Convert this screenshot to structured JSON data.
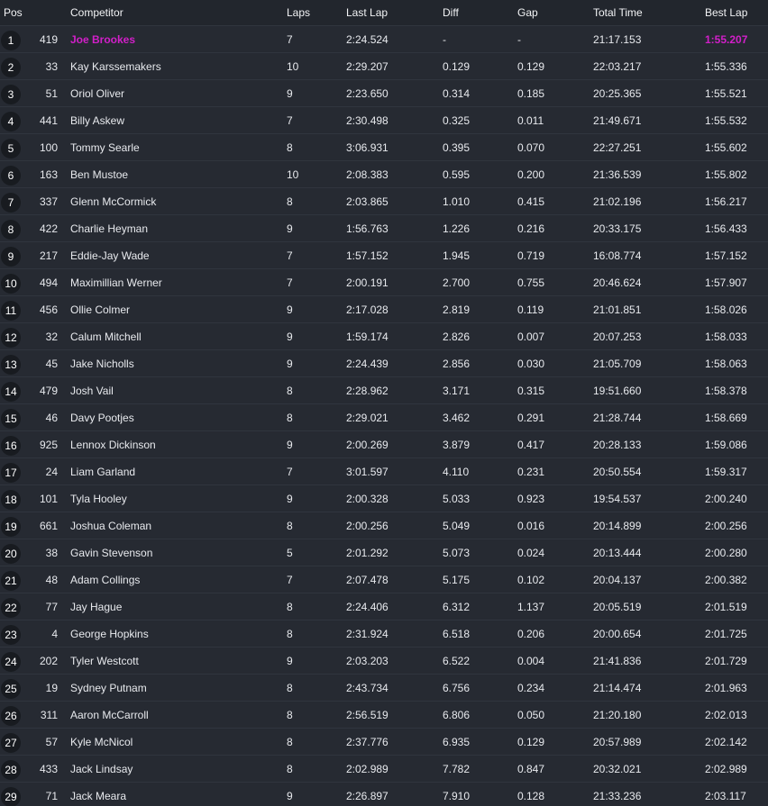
{
  "colors": {
    "background": "#242830",
    "row_divider": "#30353e",
    "badge_bg": "#181b20",
    "leader_highlight": "#d21fc9"
  },
  "columns": {
    "pos": "Pos",
    "competitor": "Competitor",
    "laps": "Laps",
    "last_lap": "Last Lap",
    "diff": "Diff",
    "gap": "Gap",
    "total_time": "Total Time",
    "best_lap": "Best Lap"
  },
  "rows": [
    {
      "pos": "1",
      "num": "419",
      "name": "Joe Brookes",
      "laps": "7",
      "last": "2:24.524",
      "diff": "-",
      "gap": "-",
      "total": "21:17.153",
      "best": "1:55.207"
    },
    {
      "pos": "2",
      "num": "33",
      "name": "Kay Karssemakers",
      "laps": "10",
      "last": "2:29.207",
      "diff": "0.129",
      "gap": "0.129",
      "total": "22:03.217",
      "best": "1:55.336"
    },
    {
      "pos": "3",
      "num": "51",
      "name": "Oriol Oliver",
      "laps": "9",
      "last": "2:23.650",
      "diff": "0.314",
      "gap": "0.185",
      "total": "20:25.365",
      "best": "1:55.521"
    },
    {
      "pos": "4",
      "num": "441",
      "name": "Billy Askew",
      "laps": "7",
      "last": "2:30.498",
      "diff": "0.325",
      "gap": "0.011",
      "total": "21:49.671",
      "best": "1:55.532"
    },
    {
      "pos": "5",
      "num": "100",
      "name": "Tommy Searle",
      "laps": "8",
      "last": "3:06.931",
      "diff": "0.395",
      "gap": "0.070",
      "total": "22:27.251",
      "best": "1:55.602"
    },
    {
      "pos": "6",
      "num": "163",
      "name": "Ben Mustoe",
      "laps": "10",
      "last": "2:08.383",
      "diff": "0.595",
      "gap": "0.200",
      "total": "21:36.539",
      "best": "1:55.802"
    },
    {
      "pos": "7",
      "num": "337",
      "name": "Glenn McCormick",
      "laps": "8",
      "last": "2:03.865",
      "diff": "1.010",
      "gap": "0.415",
      "total": "21:02.196",
      "best": "1:56.217"
    },
    {
      "pos": "8",
      "num": "422",
      "name": "Charlie Heyman",
      "laps": "9",
      "last": "1:56.763",
      "diff": "1.226",
      "gap": "0.216",
      "total": "20:33.175",
      "best": "1:56.433"
    },
    {
      "pos": "9",
      "num": "217",
      "name": "Eddie-Jay Wade",
      "laps": "7",
      "last": "1:57.152",
      "diff": "1.945",
      "gap": "0.719",
      "total": "16:08.774",
      "best": "1:57.152"
    },
    {
      "pos": "10",
      "num": "494",
      "name": "Maximillian Werner",
      "laps": "7",
      "last": "2:00.191",
      "diff": "2.700",
      "gap": "0.755",
      "total": "20:46.624",
      "best": "1:57.907"
    },
    {
      "pos": "11",
      "num": "456",
      "name": "Ollie Colmer",
      "laps": "9",
      "last": "2:17.028",
      "diff": "2.819",
      "gap": "0.119",
      "total": "21:01.851",
      "best": "1:58.026"
    },
    {
      "pos": "12",
      "num": "32",
      "name": "Calum Mitchell",
      "laps": "9",
      "last": "1:59.174",
      "diff": "2.826",
      "gap": "0.007",
      "total": "20:07.253",
      "best": "1:58.033"
    },
    {
      "pos": "13",
      "num": "45",
      "name": "Jake Nicholls",
      "laps": "9",
      "last": "2:24.439",
      "diff": "2.856",
      "gap": "0.030",
      "total": "21:05.709",
      "best": "1:58.063"
    },
    {
      "pos": "14",
      "num": "479",
      "name": "Josh Vail",
      "laps": "8",
      "last": "2:28.962",
      "diff": "3.171",
      "gap": "0.315",
      "total": "19:51.660",
      "best": "1:58.378"
    },
    {
      "pos": "15",
      "num": "46",
      "name": "Davy Pootjes",
      "laps": "8",
      "last": "2:29.021",
      "diff": "3.462",
      "gap": "0.291",
      "total": "21:28.744",
      "best": "1:58.669"
    },
    {
      "pos": "16",
      "num": "925",
      "name": "Lennox Dickinson",
      "laps": "9",
      "last": "2:00.269",
      "diff": "3.879",
      "gap": "0.417",
      "total": "20:28.133",
      "best": "1:59.086"
    },
    {
      "pos": "17",
      "num": "24",
      "name": "Liam Garland",
      "laps": "7",
      "last": "3:01.597",
      "diff": "4.110",
      "gap": "0.231",
      "total": "20:50.554",
      "best": "1:59.317"
    },
    {
      "pos": "18",
      "num": "101",
      "name": "Tyla Hooley",
      "laps": "9",
      "last": "2:00.328",
      "diff": "5.033",
      "gap": "0.923",
      "total": "19:54.537",
      "best": "2:00.240"
    },
    {
      "pos": "19",
      "num": "661",
      "name": "Joshua Coleman",
      "laps": "8",
      "last": "2:00.256",
      "diff": "5.049",
      "gap": "0.016",
      "total": "20:14.899",
      "best": "2:00.256"
    },
    {
      "pos": "20",
      "num": "38",
      "name": "Gavin Stevenson",
      "laps": "5",
      "last": "2:01.292",
      "diff": "5.073",
      "gap": "0.024",
      "total": "20:13.444",
      "best": "2:00.280"
    },
    {
      "pos": "21",
      "num": "48",
      "name": "Adam Collings",
      "laps": "7",
      "last": "2:07.478",
      "diff": "5.175",
      "gap": "0.102",
      "total": "20:04.137",
      "best": "2:00.382"
    },
    {
      "pos": "22",
      "num": "77",
      "name": "Jay Hague",
      "laps": "8",
      "last": "2:24.406",
      "diff": "6.312",
      "gap": "1.137",
      "total": "20:05.519",
      "best": "2:01.519"
    },
    {
      "pos": "23",
      "num": "4",
      "name": "George Hopkins",
      "laps": "8",
      "last": "2:31.924",
      "diff": "6.518",
      "gap": "0.206",
      "total": "20:00.654",
      "best": "2:01.725"
    },
    {
      "pos": "24",
      "num": "202",
      "name": "Tyler Westcott",
      "laps": "9",
      "last": "2:03.203",
      "diff": "6.522",
      "gap": "0.004",
      "total": "21:41.836",
      "best": "2:01.729"
    },
    {
      "pos": "25",
      "num": "19",
      "name": "Sydney Putnam",
      "laps": "8",
      "last": "2:43.734",
      "diff": "6.756",
      "gap": "0.234",
      "total": "21:14.474",
      "best": "2:01.963"
    },
    {
      "pos": "26",
      "num": "311",
      "name": "Aaron McCarroll",
      "laps": "8",
      "last": "2:56.519",
      "diff": "6.806",
      "gap": "0.050",
      "total": "21:20.180",
      "best": "2:02.013"
    },
    {
      "pos": "27",
      "num": "57",
      "name": "Kyle McNicol",
      "laps": "8",
      "last": "2:37.776",
      "diff": "6.935",
      "gap": "0.129",
      "total": "20:57.989",
      "best": "2:02.142"
    },
    {
      "pos": "28",
      "num": "433",
      "name": "Jack Lindsay",
      "laps": "8",
      "last": "2:02.989",
      "diff": "7.782",
      "gap": "0.847",
      "total": "20:32.021",
      "best": "2:02.989"
    },
    {
      "pos": "29",
      "num": "71",
      "name": "Jack Meara",
      "laps": "9",
      "last": "2:26.897",
      "diff": "7.910",
      "gap": "0.128",
      "total": "21:33.236",
      "best": "2:03.117"
    }
  ]
}
